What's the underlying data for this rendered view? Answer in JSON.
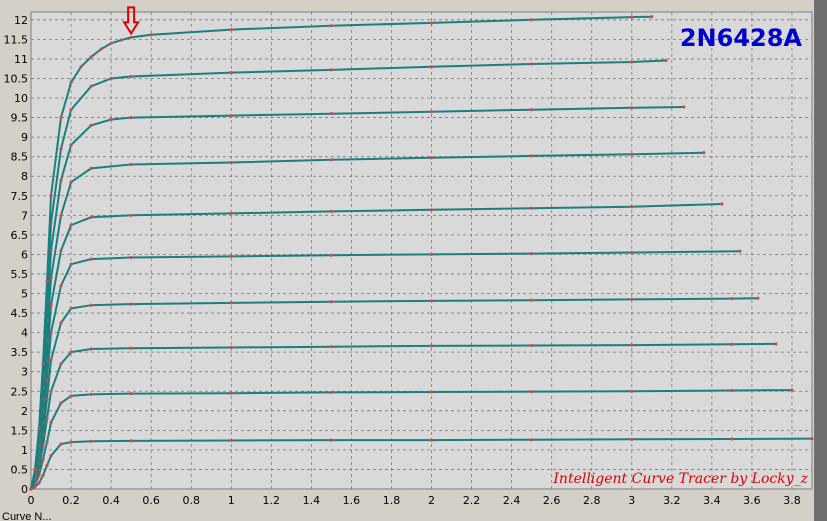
{
  "chart_data": {
    "type": "line",
    "title": "",
    "device_label": "2N6428A",
    "watermark": "Intelligent Curve Tracer by Locky_z",
    "xlabel": "",
    "ylabel": "",
    "xlim": [
      0,
      3.9
    ],
    "ylim": [
      0,
      12.2
    ],
    "grid": true,
    "x_ticks": [
      "0",
      "0.2",
      "0.4",
      "0.6",
      "0.8",
      "1",
      "1.2",
      "1.4",
      "1.6",
      "1.8",
      "2",
      "2.2",
      "2.4",
      "2.6",
      "2.8",
      "3",
      "3.2",
      "3.4",
      "3.6",
      "3.8"
    ],
    "y_ticks": [
      "0",
      "0.5",
      "1",
      "1.5",
      "2",
      "2.5",
      "3",
      "3.5",
      "4",
      "4.5",
      "5",
      "5.5",
      "6",
      "6.5",
      "7",
      "7.5",
      "8",
      "8.5",
      "9",
      "9.5",
      "10",
      "10.5",
      "11",
      "11.5",
      "12"
    ],
    "marker_arrow_at": {
      "x": 0.5,
      "y": 11.5
    },
    "series": [
      {
        "x": [
          0,
          0.02,
          0.04,
          0.06,
          0.08,
          0.1,
          0.15,
          0.2,
          0.3,
          0.5,
          1,
          1.5,
          2,
          2.5,
          3,
          3.5,
          3.9
        ],
        "values": [
          0,
          0.05,
          0.15,
          0.35,
          0.6,
          0.85,
          1.15,
          1.2,
          1.22,
          1.23,
          1.24,
          1.25,
          1.25,
          1.26,
          1.27,
          1.28,
          1.29
        ]
      },
      {
        "x": [
          0,
          0.02,
          0.04,
          0.06,
          0.08,
          0.1,
          0.15,
          0.2,
          0.3,
          0.5,
          1,
          1.5,
          2,
          2.5,
          3,
          3.5,
          3.8
        ],
        "values": [
          0,
          0.1,
          0.35,
          0.75,
          1.2,
          1.7,
          2.2,
          2.38,
          2.42,
          2.44,
          2.45,
          2.47,
          2.48,
          2.49,
          2.5,
          2.52,
          2.53
        ]
      },
      {
        "x": [
          0,
          0.02,
          0.04,
          0.06,
          0.08,
          0.1,
          0.15,
          0.2,
          0.3,
          0.5,
          1,
          1.5,
          2,
          2.5,
          3,
          3.5,
          3.72
        ],
        "values": [
          0,
          0.15,
          0.5,
          1.1,
          1.8,
          2.5,
          3.2,
          3.5,
          3.58,
          3.6,
          3.62,
          3.64,
          3.66,
          3.67,
          3.68,
          3.7,
          3.71
        ]
      },
      {
        "x": [
          0,
          0.02,
          0.04,
          0.06,
          0.08,
          0.1,
          0.15,
          0.2,
          0.3,
          0.5,
          1,
          1.5,
          2,
          2.5,
          3,
          3.5,
          3.63
        ],
        "values": [
          0,
          0.2,
          0.65,
          1.4,
          2.3,
          3.3,
          4.25,
          4.62,
          4.7,
          4.73,
          4.76,
          4.79,
          4.81,
          4.83,
          4.85,
          4.87,
          4.88
        ]
      },
      {
        "x": [
          0,
          0.02,
          0.04,
          0.06,
          0.08,
          0.1,
          0.15,
          0.2,
          0.3,
          0.5,
          1,
          1.5,
          2,
          2.5,
          3,
          3.54
        ],
        "values": [
          0,
          0.25,
          0.8,
          1.7,
          2.8,
          4.0,
          5.2,
          5.75,
          5.88,
          5.92,
          5.95,
          5.98,
          6.0,
          6.02,
          6.05,
          6.08
        ]
      },
      {
        "x": [
          0,
          0.02,
          0.04,
          0.06,
          0.08,
          0.1,
          0.15,
          0.2,
          0.3,
          0.5,
          1,
          1.5,
          2,
          2.5,
          3,
          3.45
        ],
        "values": [
          0,
          0.3,
          0.95,
          2.0,
          3.3,
          4.7,
          6.1,
          6.75,
          6.95,
          7.0,
          7.05,
          7.1,
          7.14,
          7.18,
          7.22,
          7.29
        ]
      },
      {
        "x": [
          0,
          0.02,
          0.04,
          0.06,
          0.08,
          0.1,
          0.15,
          0.2,
          0.3,
          0.5,
          1,
          1.5,
          2,
          2.5,
          3,
          3.36
        ],
        "values": [
          0,
          0.35,
          1.1,
          2.3,
          3.8,
          5.4,
          7.0,
          7.85,
          8.2,
          8.3,
          8.35,
          8.42,
          8.47,
          8.52,
          8.56,
          8.6
        ]
      },
      {
        "x": [
          0,
          0.02,
          0.04,
          0.06,
          0.08,
          0.1,
          0.15,
          0.2,
          0.3,
          0.4,
          0.5,
          1,
          1.5,
          2,
          2.5,
          3,
          3.26
        ],
        "values": [
          0,
          0.4,
          1.25,
          2.6,
          4.3,
          6.1,
          7.9,
          8.8,
          9.3,
          9.45,
          9.5,
          9.55,
          9.6,
          9.65,
          9.7,
          9.75,
          9.77
        ]
      },
      {
        "x": [
          0,
          0.02,
          0.04,
          0.06,
          0.08,
          0.1,
          0.15,
          0.2,
          0.3,
          0.4,
          0.5,
          1,
          1.5,
          2,
          2.5,
          3,
          3.17
        ],
        "values": [
          0,
          0.45,
          1.4,
          2.9,
          4.8,
          6.8,
          8.7,
          9.7,
          10.3,
          10.5,
          10.55,
          10.65,
          10.72,
          10.8,
          10.87,
          10.92,
          10.96
        ]
      },
      {
        "x": [
          0,
          0.02,
          0.04,
          0.06,
          0.08,
          0.1,
          0.15,
          0.2,
          0.25,
          0.3,
          0.35,
          0.4,
          0.45,
          0.5,
          0.6,
          1,
          1.5,
          2,
          2.5,
          3,
          3.1
        ],
        "values": [
          0,
          0.5,
          1.55,
          3.2,
          5.3,
          7.5,
          9.5,
          10.4,
          10.8,
          11.05,
          11.25,
          11.4,
          11.48,
          11.55,
          11.62,
          11.75,
          11.85,
          11.92,
          12.0,
          12.07,
          12.08
        ]
      }
    ]
  },
  "status": {
    "text": "Curve N..."
  }
}
